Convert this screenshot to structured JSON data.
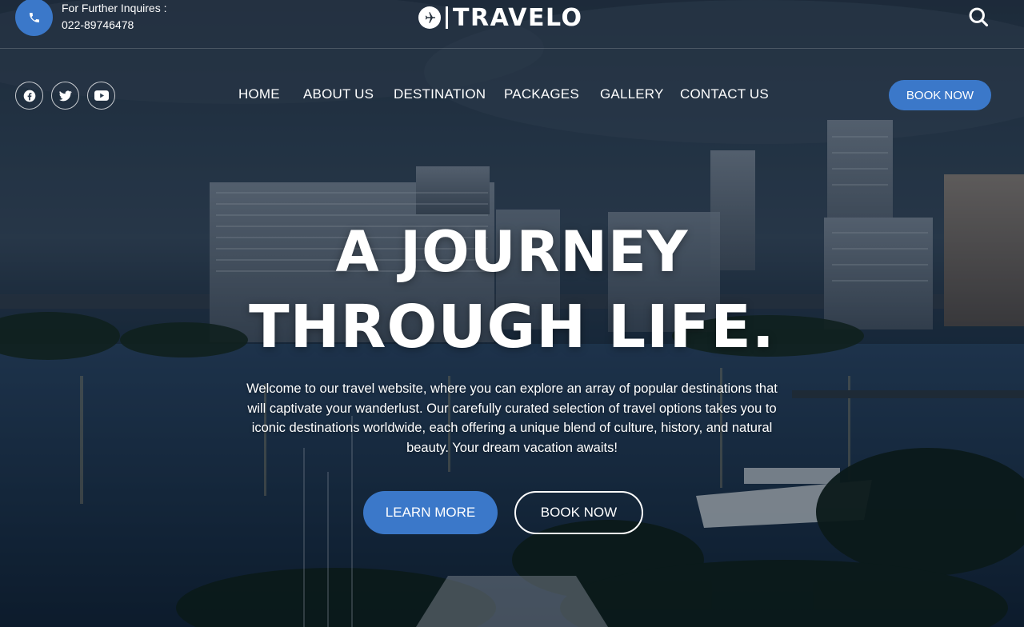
{
  "topbar": {
    "inquiry_label": "For Further Inquires :",
    "phone": "022-89746478",
    "phone_icon": "phone-icon",
    "search_icon": "search-icon"
  },
  "logo": {
    "text": "TRAVELO",
    "icon": "airplane-icon"
  },
  "social": {
    "items": [
      {
        "icon": "facebook-icon"
      },
      {
        "icon": "twitter-icon"
      },
      {
        "icon": "youtube-icon"
      }
    ]
  },
  "nav": {
    "items": [
      {
        "label": "HOME"
      },
      {
        "label": "ABOUT US"
      },
      {
        "label": "DESTINATION"
      },
      {
        "label": "PACKAGES"
      },
      {
        "label": "GALLERY"
      },
      {
        "label": "CONTACT US"
      }
    ],
    "book_now": "BOOK NOW"
  },
  "hero": {
    "headline_line1": "A JOURNEY",
    "headline_line2": "THROUGH LIFE.",
    "intro_lines": [
      "Welcome to our travel website, where you can explore an array of popular destinations that",
      "will captivate your wanderlust. Our carefully curated selection of travel options takes you to",
      "iconic destinations worldwide, each offering a unique blend of culture, history, and natural",
      "beauty. Your dream vacation awaits!"
    ],
    "learn_more": "LEARN MORE",
    "book_now": "BOOK NOW"
  },
  "colors": {
    "accent": "#3b78c9",
    "text": "#ffffff"
  }
}
